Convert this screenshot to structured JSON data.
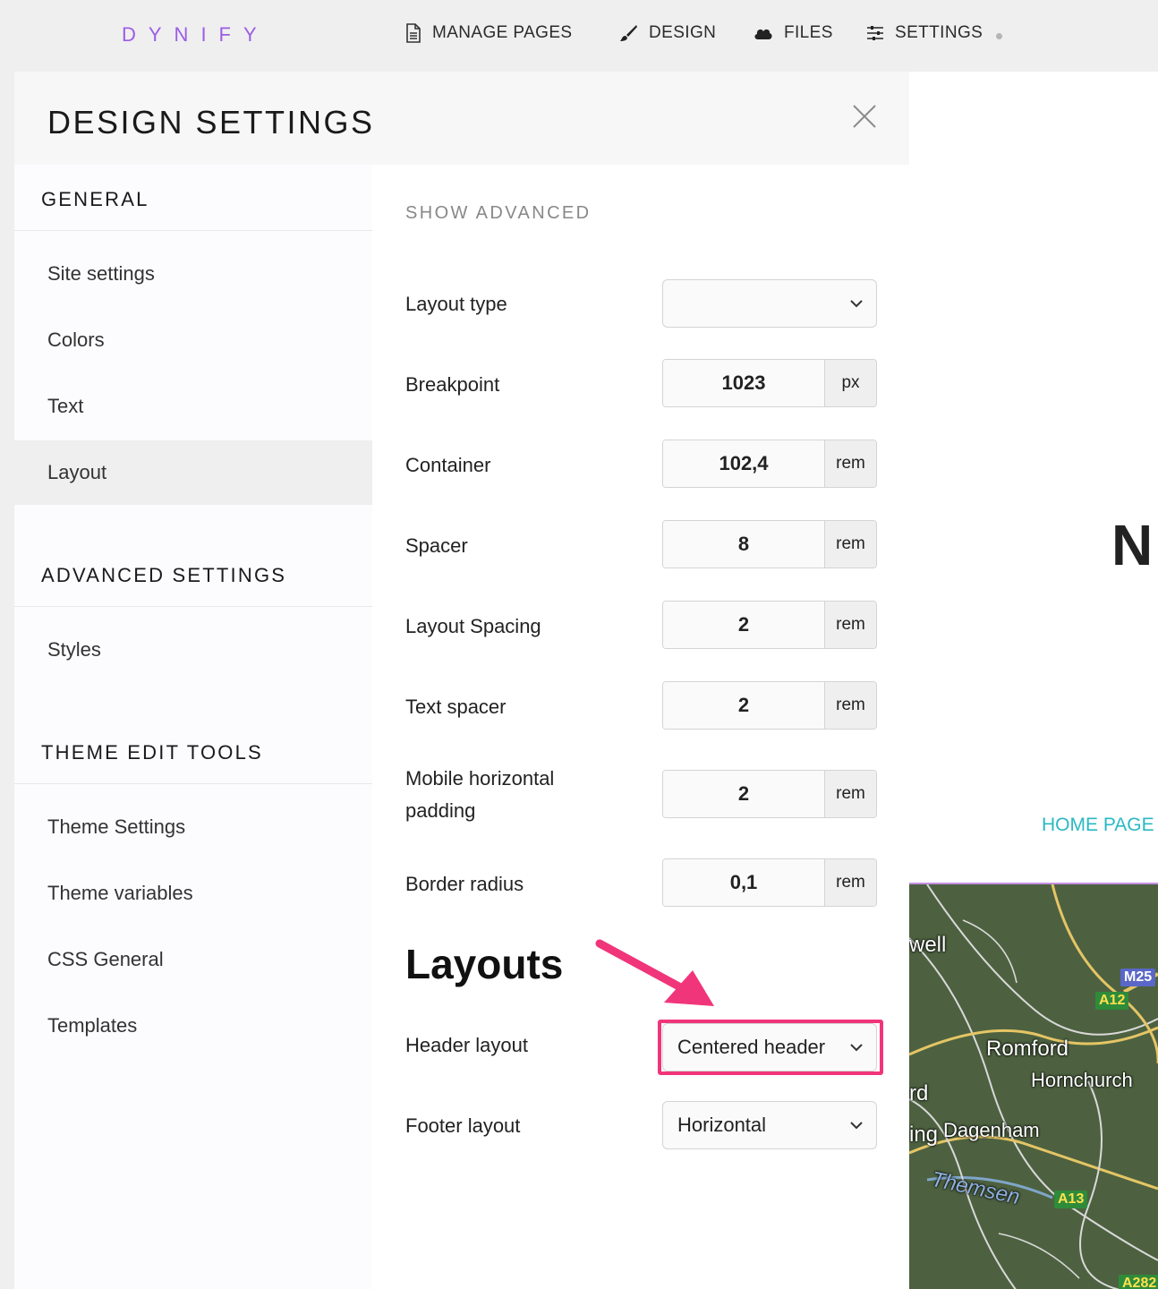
{
  "brand": {
    "logo": "DYNIFY",
    "accent": "#9b5de5"
  },
  "nav": {
    "manage_pages": "MANAGE PAGES",
    "design": "DESIGN",
    "files": "FILES",
    "settings": "SETTINGS"
  },
  "panel": {
    "title": "DESIGN SETTINGS",
    "sidebar": {
      "general_heading": "GENERAL",
      "general_items": [
        "Site settings",
        "Colors",
        "Text",
        "Layout"
      ],
      "active_item": "Layout",
      "advanced_heading": "ADVANCED SETTINGS",
      "advanced_items": [
        "Styles"
      ],
      "theme_heading": "THEME EDIT TOOLS",
      "theme_items": [
        "Theme Settings",
        "Theme variables",
        "CSS General",
        "Templates"
      ]
    },
    "content": {
      "show_advanced": "SHOW ADVANCED",
      "layout_type": {
        "label": "Layout type",
        "value": ""
      },
      "breakpoint": {
        "label": "Breakpoint",
        "value": "1023",
        "unit": "px"
      },
      "container": {
        "label": "Container",
        "value": "102,4",
        "unit": "rem"
      },
      "spacer": {
        "label": "Spacer",
        "value": "8",
        "unit": "rem"
      },
      "layout_spacing": {
        "label": "Layout Spacing",
        "value": "2",
        "unit": "rem"
      },
      "text_spacer": {
        "label": "Text spacer",
        "value": "2",
        "unit": "rem"
      },
      "mobile_padding": {
        "label": "Mobile horizontal padding",
        "value": "2",
        "unit": "rem"
      },
      "border_radius": {
        "label": "Border radius",
        "value": "0,1",
        "unit": "rem"
      },
      "layouts_heading": "Layouts",
      "header_layout": {
        "label": "Header layout",
        "value": "Centered header"
      },
      "footer_layout": {
        "label": "Footer layout",
        "value": "Horizontal"
      },
      "highlight_color": "#f0357a"
    }
  },
  "preview": {
    "heading_letter": "N",
    "home_link": "HOME PAGE",
    "map_labels": [
      "well",
      "Romford",
      "Hornchurch",
      "rd",
      "ing",
      "Dagenham",
      "Themsen"
    ],
    "map_badges": [
      "M25",
      "A12",
      "A13",
      "A282"
    ]
  }
}
